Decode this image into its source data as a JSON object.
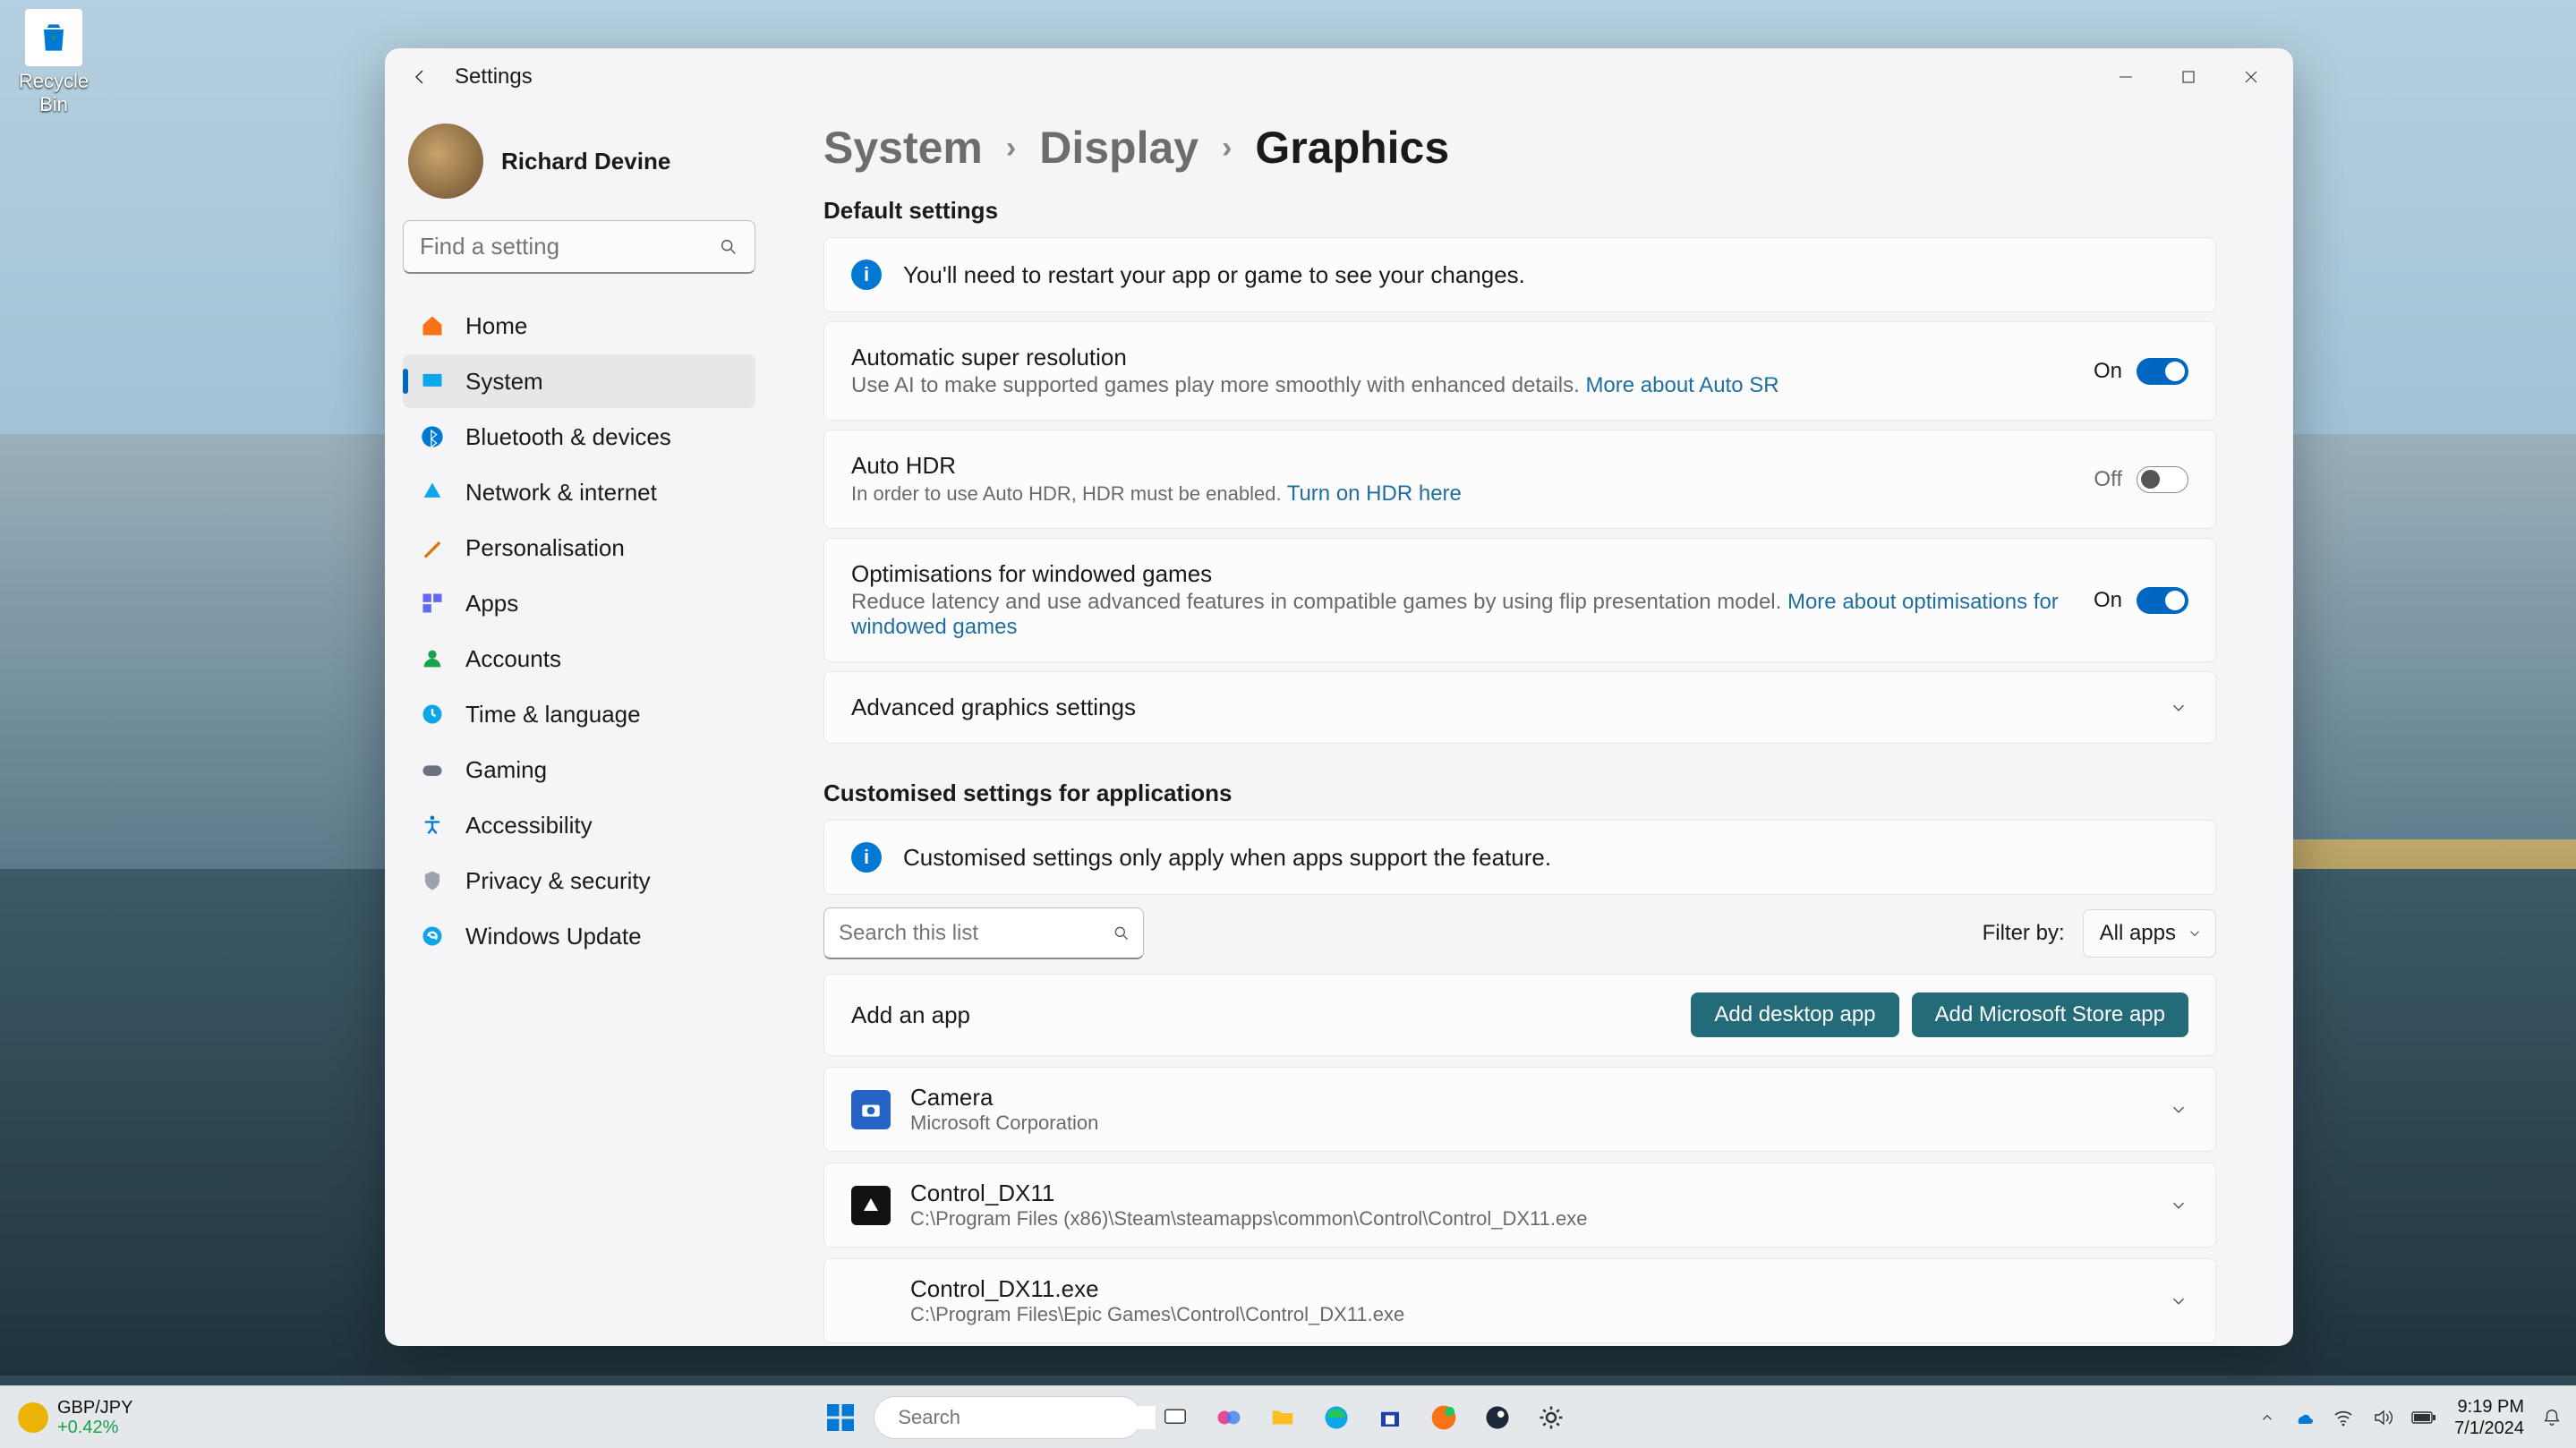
{
  "desktop": {
    "recycle_label": "Recycle Bin"
  },
  "window": {
    "app_title": "Settings",
    "user_name": "Richard Devine",
    "search_placeholder": "Find a setting"
  },
  "nav": [
    {
      "label": "Home",
      "icon": "home"
    },
    {
      "label": "System",
      "icon": "system",
      "active": true
    },
    {
      "label": "Bluetooth & devices",
      "icon": "bluetooth"
    },
    {
      "label": "Network & internet",
      "icon": "network"
    },
    {
      "label": "Personalisation",
      "icon": "personalisation"
    },
    {
      "label": "Apps",
      "icon": "apps"
    },
    {
      "label": "Accounts",
      "icon": "accounts"
    },
    {
      "label": "Time & language",
      "icon": "time"
    },
    {
      "label": "Gaming",
      "icon": "gaming"
    },
    {
      "label": "Accessibility",
      "icon": "accessibility"
    },
    {
      "label": "Privacy & security",
      "icon": "privacy"
    },
    {
      "label": "Windows Update",
      "icon": "update"
    }
  ],
  "breadcrumb": {
    "l1": "System",
    "l2": "Display",
    "current": "Graphics"
  },
  "sections": {
    "default_h": "Default settings",
    "info1": "You'll need to restart your app or game to see your changes.",
    "asr": {
      "title": "Automatic super resolution",
      "desc": "Use AI to make supported games play more smoothly with enhanced details.  ",
      "link": "More about Auto SR",
      "state": "On"
    },
    "hdr": {
      "title": "Auto HDR",
      "desc": "In order to use Auto HDR, HDR must be enabled.  ",
      "link": "Turn on HDR here",
      "state": "Off"
    },
    "opt": {
      "title": "Optimisations for windowed games",
      "desc": "Reduce latency and use advanced features in compatible games by using flip presentation model.  ",
      "link": "More about optimisations for windowed games",
      "state": "On"
    },
    "advanced": "Advanced graphics settings",
    "custom_h": "Customised settings for applications",
    "info2": "Customised settings only apply when apps support the feature.",
    "list_search_placeholder": "Search this list",
    "filter_label": "Filter by:",
    "filter_value": "All apps",
    "add_label": "Add an app",
    "btn_desktop": "Add desktop app",
    "btn_store": "Add Microsoft Store app"
  },
  "apps": [
    {
      "name": "Camera",
      "sub": "Microsoft Corporation",
      "icon": "camera"
    },
    {
      "name": "Control_DX11",
      "sub": "C:\\Program Files (x86)\\Steam\\steamapps\\common\\Control\\Control_DX11.exe",
      "icon": "dark"
    },
    {
      "name": "Control_DX11.exe",
      "sub": "C:\\Program Files\\Epic Games\\Control\\Control_DX11.exe",
      "icon": "blank"
    }
  ],
  "taskbar": {
    "widget_l1": "GBP/JPY",
    "widget_l2": "+0.42%",
    "search_placeholder": "Search",
    "time": "9:19 PM",
    "date": "7/1/2024"
  }
}
